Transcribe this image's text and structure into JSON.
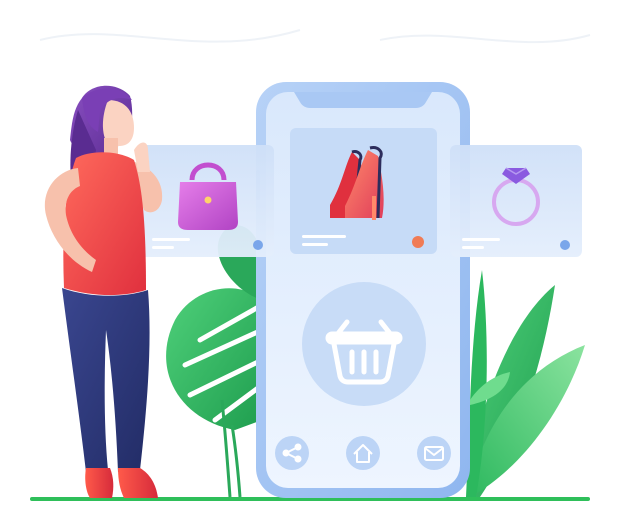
{
  "scene": {
    "products": [
      {
        "name": "handbag"
      },
      {
        "name": "high-heels"
      },
      {
        "name": "ring"
      }
    ],
    "nav_icons": [
      "share-icon",
      "home-icon",
      "mail-icon"
    ],
    "center_icon": "basket-icon"
  },
  "colors": {
    "phone_frame": "#a9c8f4",
    "phone_screen": "#dbe9fb",
    "card": "#d8e6fa",
    "card_dot": "#7aa6ea",
    "heel_dot": "#f07b55",
    "leaf_green": "#3fbf6a",
    "ground": "#2fbf5a",
    "shirt": "#ee4b4b",
    "pants": "#2e3a7c",
    "hair": "#6d3aa6",
    "bag": "#c24fcf",
    "gem": "#8a5be0"
  }
}
